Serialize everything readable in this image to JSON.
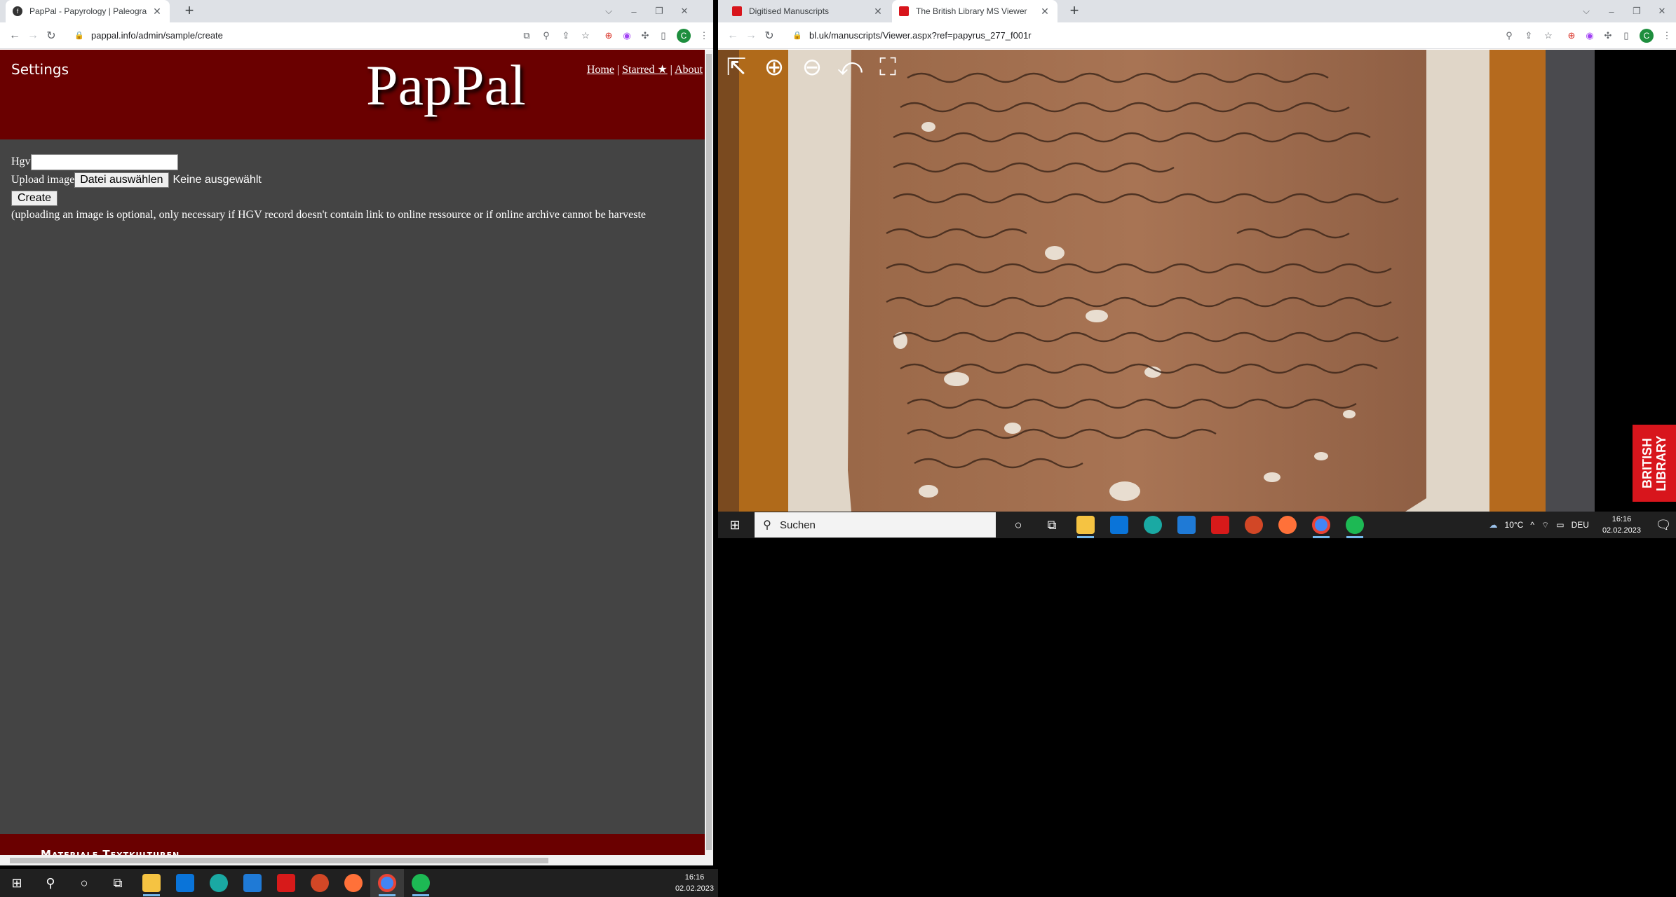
{
  "left_browser": {
    "tabs": [
      {
        "title": "PapPal - Papyrology | Paleograph",
        "active": true
      }
    ],
    "url": "pappal.info/admin/sample/create"
  },
  "pappal": {
    "settings": "Settings",
    "logo": "PapPal",
    "nav": {
      "home": "Home",
      "sep": "|",
      "starred": "Starred ★",
      "about": "About"
    },
    "form": {
      "hgv_label": "Hgv",
      "hgv_value": "",
      "upload_label": "Upload image",
      "file_button": "Datei auswählen",
      "file_status": "Keine ausgewählt",
      "create_button": "Create",
      "note": "(uploading an image is optional, only necessary if HGV record doesn't contain link to online ressource or if online archive cannot be harveste"
    },
    "footer": "Materiale Textkulturen"
  },
  "right_browser": {
    "tabs": [
      {
        "title": "Digitised Manuscripts",
        "active": false
      },
      {
        "title": "The British Library MS Viewer",
        "active": true
      }
    ],
    "url": "bl.uk/manuscripts/Viewer.aspx?ref=papyrus_277_f001r"
  },
  "viewer": {
    "tools": [
      "exit-icon",
      "zoom-in-icon",
      "zoom-out-icon",
      "rotate-icon",
      "fullscreen-icon"
    ],
    "badge": "BRITISH LIBRARY"
  },
  "taskbar_main": {
    "time": "16:16",
    "date": "02.02.2023"
  },
  "taskbar_right": {
    "search_placeholder": "Suchen",
    "weather": "10°C",
    "lang": "DEU",
    "time": "16:16",
    "date": "02.02.2023"
  },
  "profile_letter": "C"
}
